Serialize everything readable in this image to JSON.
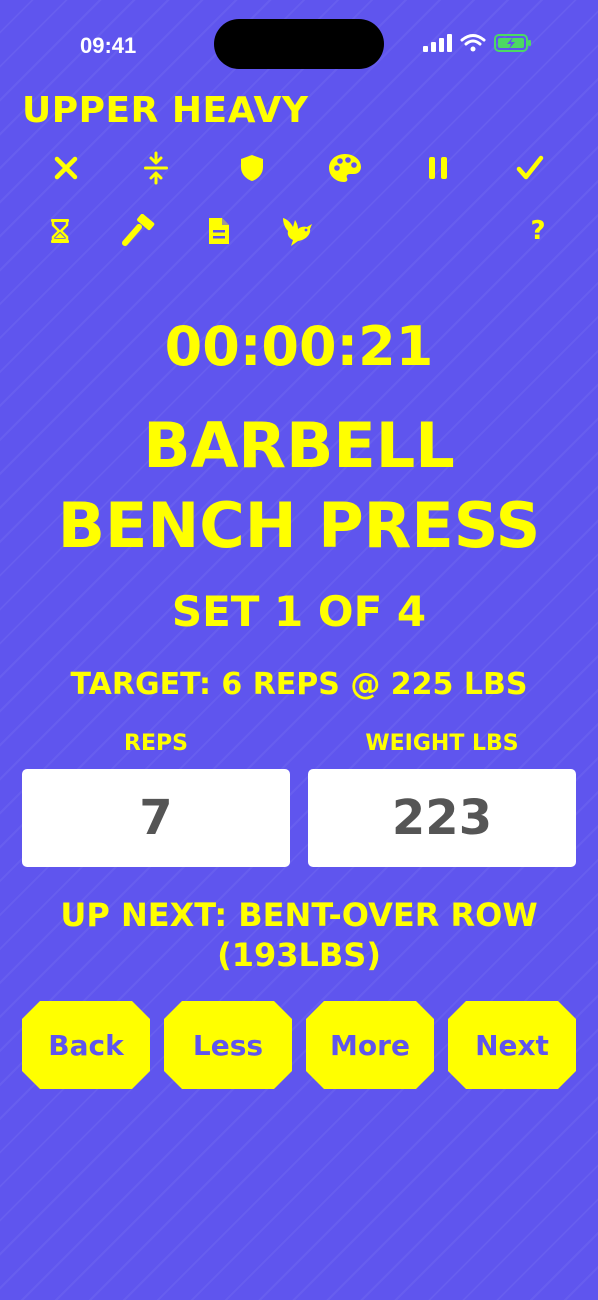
{
  "status_bar": {
    "time": "09:41"
  },
  "workout": {
    "title": "UPPER HEAVY"
  },
  "toolbar": {
    "row1": [
      "close-icon",
      "compress-icon",
      "shield-icon",
      "palette-icon",
      "pause-icon",
      "checkmark-icon"
    ],
    "row2": [
      "hourglass-icon",
      "hammer-icon",
      "document-icon",
      "bird-icon",
      "help-icon"
    ],
    "help_label": "?"
  },
  "session": {
    "timer": "00:00:21",
    "exercise_line1": "BARBELL",
    "exercise_line2": "BENCH PRESS",
    "set_label": "SET 1 OF 4",
    "target": "TARGET: 6 REPS @ 225 LBS"
  },
  "inputs": {
    "reps_label": "REPS",
    "reps_value": "7",
    "weight_label": "WEIGHT LBS",
    "weight_value": "223"
  },
  "up_next": {
    "line1": "UP NEXT: BENT-OVER ROW",
    "line2": "(193LBS)"
  },
  "nav": {
    "back_label": "Back",
    "less_label": "Less",
    "more_label": "More",
    "next_label": "Next"
  },
  "colors": {
    "background": "#5f55ee",
    "accent": "#ffff00",
    "input_text": "#555555"
  }
}
